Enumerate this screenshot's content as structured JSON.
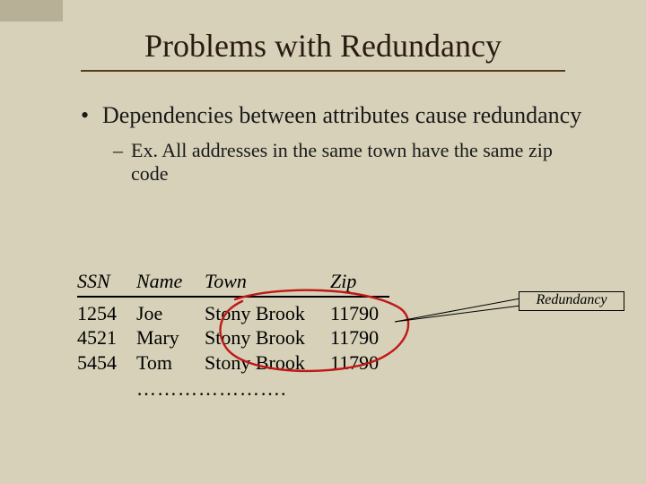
{
  "slide": {
    "title": "Problems with Redundancy",
    "bullet1": "Dependencies between attributes cause redundancy",
    "bullet2": "Ex.  All addresses in the same town have the same zip code",
    "callout_label": "Redundancy"
  },
  "table": {
    "headers": {
      "ssn": "SSN",
      "name": "Name",
      "town": "Town",
      "zip": "Zip"
    },
    "rows": [
      {
        "ssn": "1254",
        "name": "Joe",
        "town": "Stony Brook",
        "zip": "11790"
      },
      {
        "ssn": "4521",
        "name": "Mary",
        "town": "Stony Brook",
        "zip": "11790"
      },
      {
        "ssn": "5454",
        "name": "Tom",
        "town": "Stony Brook",
        "zip": "11790"
      }
    ],
    "ellipsis": "…………………."
  }
}
